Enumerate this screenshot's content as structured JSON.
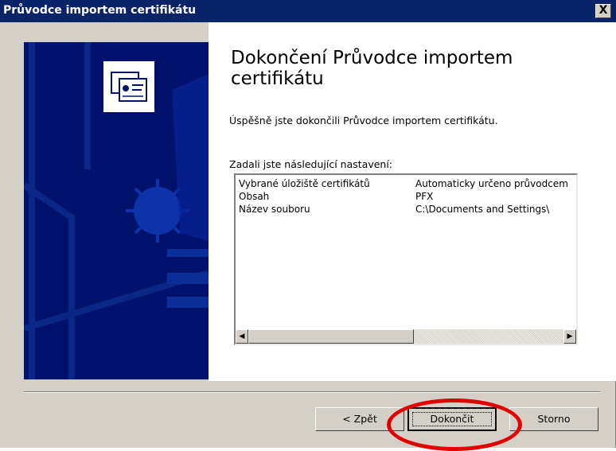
{
  "window": {
    "title": "Průvodce importem certifikátu",
    "close_label": "X"
  },
  "content": {
    "heading": "Dokončení Průvodce importem certifikátu",
    "success_text": "Úspěšně jste dokončili Průvodce importem certifikátu.",
    "settings_label": "Zadali jste následující nastavení:"
  },
  "settings_list": {
    "rows": [
      {
        "key": "Vybrané úložiště certifikátů",
        "value": "Automaticky určeno průvodcem"
      },
      {
        "key": "Obsah",
        "value": "PFX"
      },
      {
        "key": "Název souboru",
        "value": "C:\\Documents and Settings\\"
      }
    ],
    "scroll_left_arrow": "◀",
    "scroll_right_arrow": "▶"
  },
  "buttons": {
    "back": "< Zpět",
    "finish": "Dokončit",
    "cancel": "Storno"
  },
  "banner": {
    "icon": "certificate-icon",
    "background_color": "#00126b"
  },
  "highlight": {
    "color": "#e00000"
  }
}
